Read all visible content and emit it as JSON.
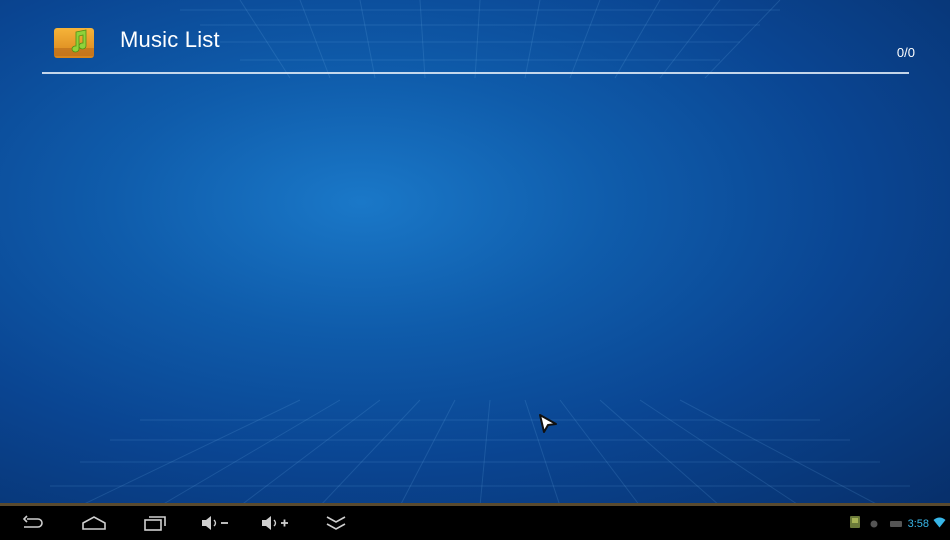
{
  "app": {
    "title": "Music List",
    "counter": "0/0",
    "icon": "music-folder-icon"
  },
  "navbar": {
    "buttons": [
      {
        "name": "back-button",
        "icon": "back-arrow-icon"
      },
      {
        "name": "home-button",
        "icon": "home-icon"
      },
      {
        "name": "recent-apps-button",
        "icon": "recent-apps-icon"
      },
      {
        "name": "volume-down-button",
        "icon": "volume-down-icon"
      },
      {
        "name": "volume-up-button",
        "icon": "volume-up-icon"
      },
      {
        "name": "hide-bar-button",
        "icon": "double-chevron-down-icon"
      }
    ]
  },
  "status": {
    "time": "3:58",
    "icons": [
      "notification-app-icon",
      "dot-icon",
      "usb-icon",
      "wifi-icon"
    ]
  },
  "colors": {
    "background_center": "#1a78c8",
    "background_edge": "#072f6a",
    "divider": "#d8e6f4",
    "clock": "#38b6e8"
  }
}
